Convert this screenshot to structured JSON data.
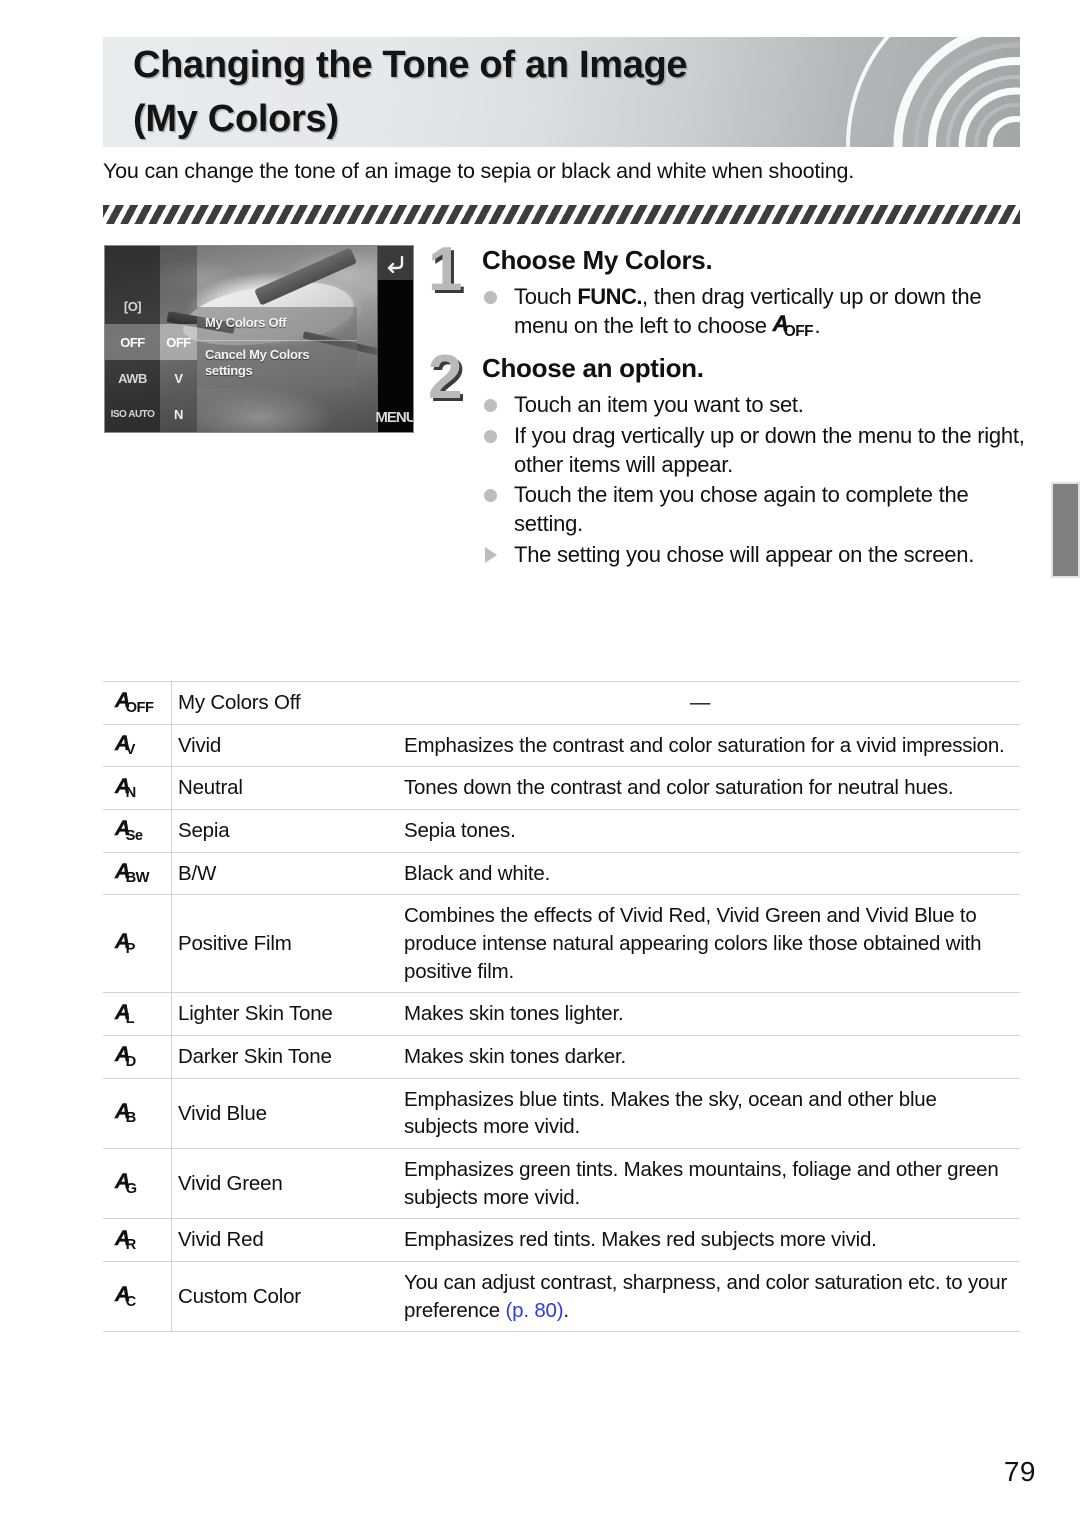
{
  "header": {
    "title_line1": "Changing the Tone of an Image",
    "title_line2": "(My Colors)"
  },
  "intro": {
    "text": "You can change the tone of an image to sepia or black and white when shooting."
  },
  "camera_screen": {
    "left_column_items": [
      "[O]",
      "OFF",
      "AWB",
      "ISO AUTO"
    ],
    "second_column_items": [
      "OFF",
      "V",
      "N"
    ],
    "popup_line1": "My Colors Off",
    "popup_line2": "Cancel My Colors settings",
    "back_icon": "back-arrow-icon",
    "menu_label": "MENU"
  },
  "steps": [
    {
      "number": "1",
      "heading": "Choose My Colors.",
      "bullets": [
        {
          "marker": "dot",
          "segments": [
            {
              "type": "text",
              "value": "Touch "
            },
            {
              "type": "func",
              "value": "FUNC."
            },
            {
              "type": "text",
              "value": ", then drag vertically up or down the menu on the left to choose "
            },
            {
              "type": "icon",
              "value": "OFF"
            },
            {
              "type": "text",
              "value": "."
            }
          ]
        }
      ]
    },
    {
      "number": "2",
      "heading": "Choose an option.",
      "bullets": [
        {
          "marker": "dot",
          "text": "Touch an item you want to set."
        },
        {
          "marker": "dot",
          "text": "If you drag vertically up or down the menu to the right, other items will appear."
        },
        {
          "marker": "dot",
          "text": "Touch the item you chose again to complete the setting."
        },
        {
          "marker": "triangle",
          "text": "The setting you chose will appear on the screen."
        }
      ]
    }
  ],
  "options_table": {
    "rows": [
      {
        "icon_sub": "OFF",
        "name": "My Colors Off",
        "desc": "—",
        "desc_centered": true
      },
      {
        "icon_sub": "V",
        "name": "Vivid",
        "desc": "Emphasizes the contrast and color saturation for a vivid impression."
      },
      {
        "icon_sub": "N",
        "name": "Neutral",
        "desc": "Tones down the contrast and color saturation for neutral hues."
      },
      {
        "icon_sub": "Se",
        "name": "Sepia",
        "desc": "Sepia tones."
      },
      {
        "icon_sub": "BW",
        "name": "B/W",
        "desc": "Black and white."
      },
      {
        "icon_sub": "P",
        "name": "Positive Film",
        "desc": "Combines the effects of Vivid Red, Vivid Green and Vivid Blue to produce intense natural appearing colors like those obtained with positive film."
      },
      {
        "icon_sub": "L",
        "name": "Lighter Skin Tone",
        "desc": "Makes skin tones lighter."
      },
      {
        "icon_sub": "D",
        "name": "Darker Skin Tone",
        "desc": "Makes skin tones darker."
      },
      {
        "icon_sub": "B",
        "name": "Vivid Blue",
        "desc": "Emphasizes blue tints. Makes the sky, ocean and other blue subjects more vivid."
      },
      {
        "icon_sub": "G",
        "name": "Vivid Green",
        "desc": "Emphasizes green tints. Makes mountains, foliage and other green subjects more vivid."
      },
      {
        "icon_sub": "R",
        "name": "Vivid Red",
        "desc": "Emphasizes red tints. Makes red subjects more vivid."
      },
      {
        "icon_sub": "C",
        "name": "Custom Color",
        "desc": "You can adjust contrast, sharpness, and color saturation etc. to your preference ",
        "page_ref": "(p. 80)",
        "desc_tail": "."
      }
    ]
  },
  "page_number": "79",
  "colors": {
    "page_ref_link": "#2b3fd6",
    "side_tab": "#808080",
    "bullet_dot": "#bdbdbd",
    "step_number": "#b9b9b9"
  }
}
